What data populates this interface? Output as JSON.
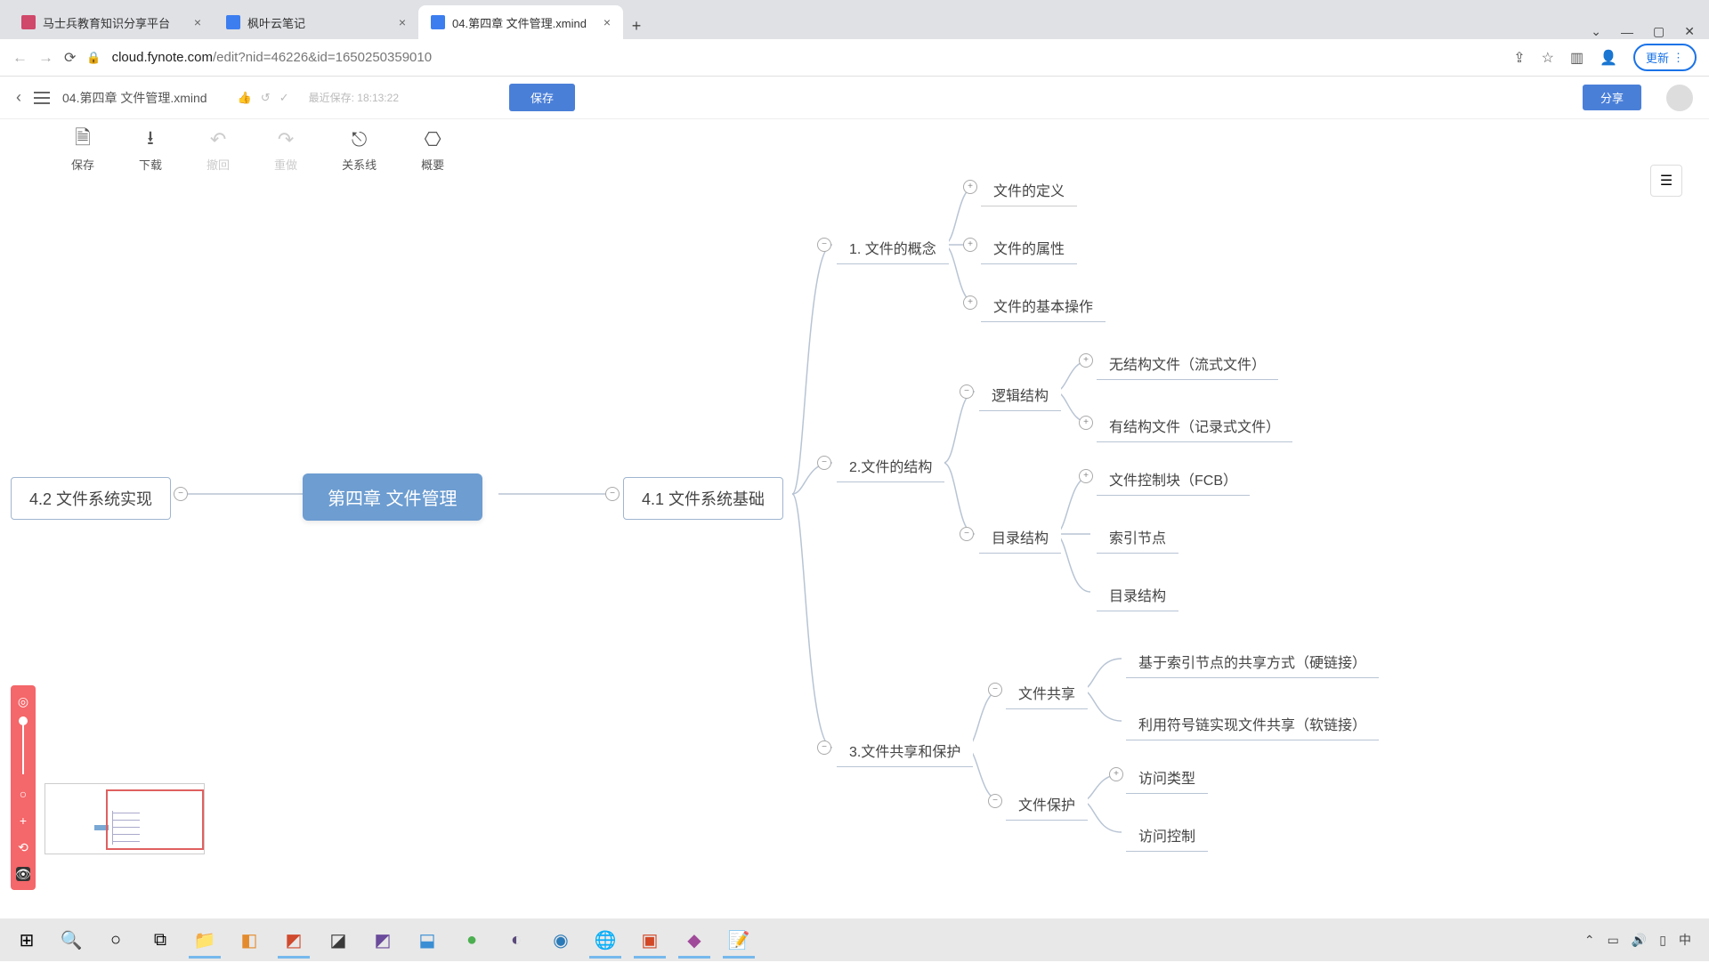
{
  "browser": {
    "tabs": [
      {
        "title": "马士兵教育知识分享平台",
        "favicon_color": "#d0486a"
      },
      {
        "title": "枫叶云笔记",
        "favicon_color": "#3c7ef0"
      },
      {
        "title": "04.第四章 文件管理.xmind",
        "favicon_color": "#3c7ef0",
        "active": true
      }
    ],
    "url_domain": "cloud.fynote.com",
    "url_path": "/edit?nid=46226&id=1650250359010",
    "update_label": "更新"
  },
  "app": {
    "doc_title": "04.第四章 文件管理.xmind",
    "save_info_prefix": "最近保存:",
    "save_info_time": "18:13:22",
    "save_btn": "保存",
    "share_btn": "分享",
    "actions": {
      "save": "保存",
      "download": "下载",
      "undo": "撤回",
      "redo": "重做",
      "relation": "关系线",
      "outline": "概要"
    }
  },
  "mindmap": {
    "root": "第四章 文件管理",
    "left": {
      "l1": "4.2 文件系统实现"
    },
    "right": {
      "l1": "4.1 文件系统基础",
      "n1": {
        "label": "1. 文件的概念",
        "children": {
          "c1": "文件的定义",
          "c2": "文件的属性",
          "c3": "文件的基本操作"
        }
      },
      "n2": {
        "label": "2.文件的结构",
        "logic": {
          "label": "逻辑结构",
          "c1": "无结构文件（流式文件）",
          "c2": "有结构文件（记录式文件）"
        },
        "dir": {
          "label": "目录结构",
          "c1": "文件控制块（FCB）",
          "c2": "索引节点",
          "c3": "目录结构"
        }
      },
      "n3": {
        "label": "3.文件共享和保护",
        "share": {
          "label": "文件共享",
          "c1": "基于索引节点的共享方式（硬链接）",
          "c2": "利用符号链实现文件共享（软链接）"
        },
        "protect": {
          "label": "文件保护",
          "c1": "访问类型",
          "c2": "访问控制"
        }
      }
    }
  },
  "taskbar": {
    "tray": {
      "ime_lang": "中"
    }
  }
}
